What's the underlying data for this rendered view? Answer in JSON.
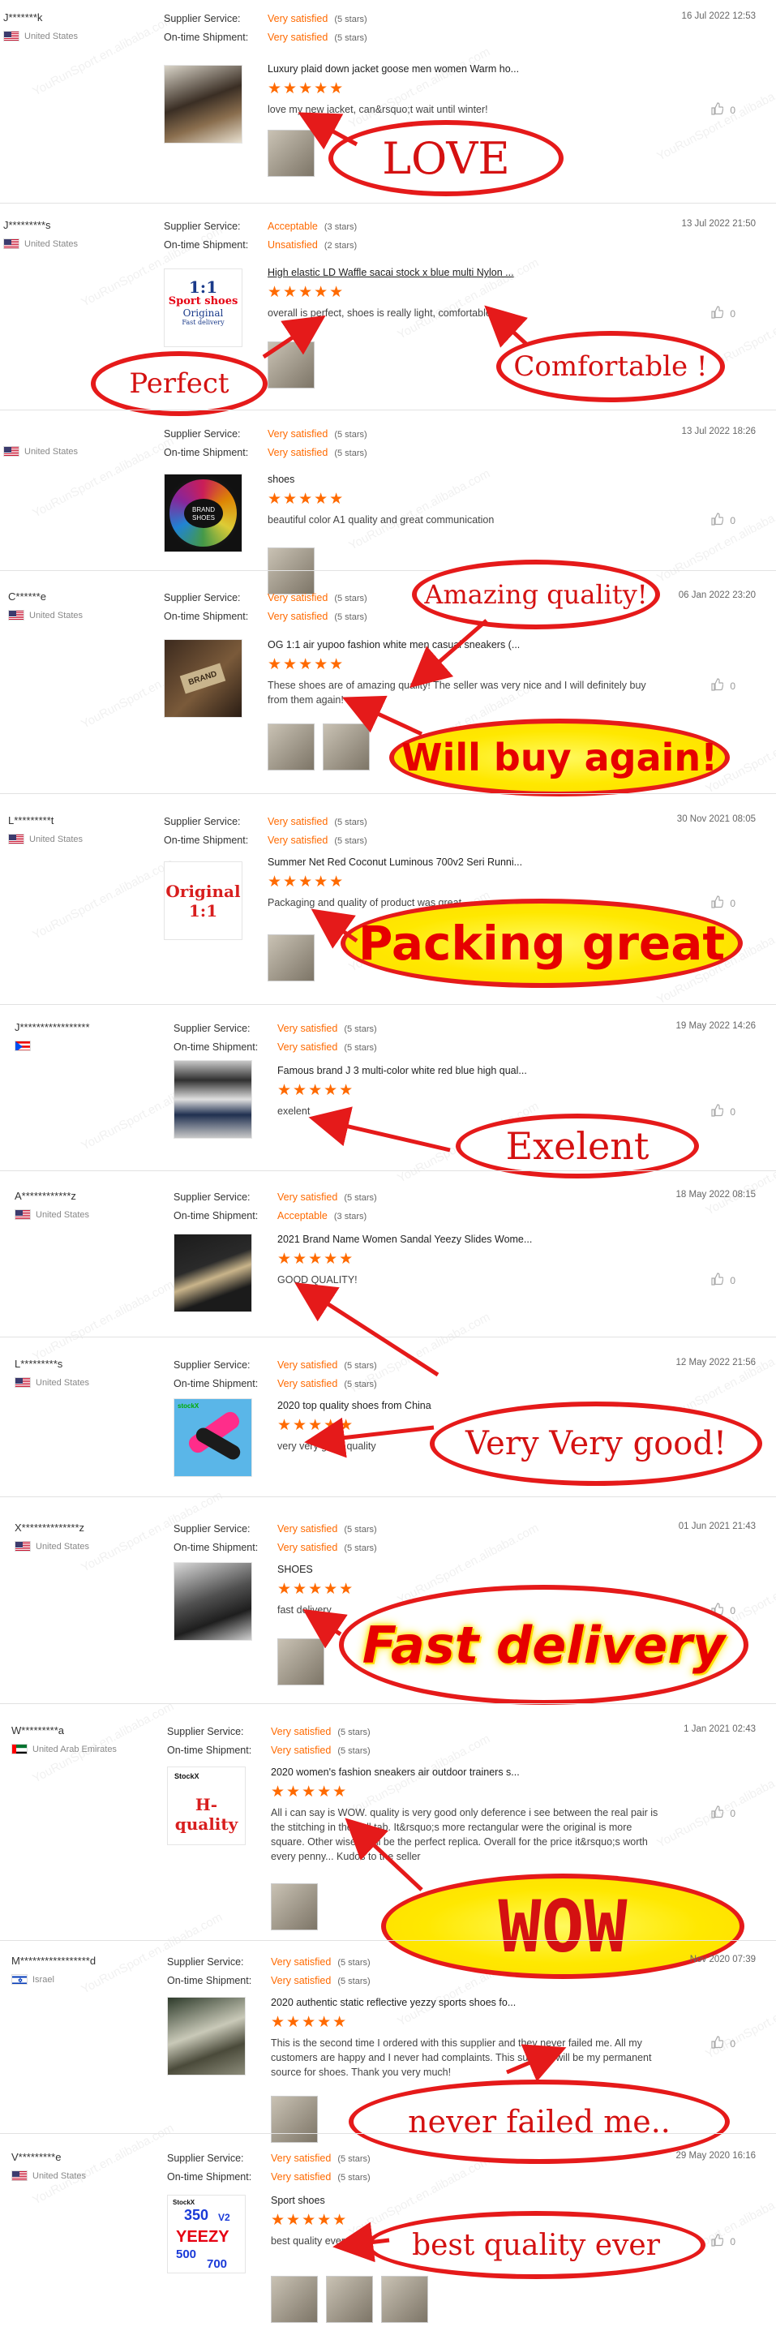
{
  "labels": {
    "supplier_service": "Supplier Service:",
    "on_time_shipment": "On-time Shipment:"
  },
  "watermark": "YouRunSport.en.alibaba.com",
  "reviews": [
    {
      "buyer": "J*******k",
      "country": "United States",
      "supplier_val": "Very satisfied",
      "supplier_stars": "(5 stars)",
      "shipment_val": "Very satisfied",
      "shipment_stars": "(5 stars)",
      "date": "16 Jul 2022 12:53",
      "product": "Luxury plaid down jacket goose men women Warm ho...",
      "rating": "★★★★★",
      "comment": "love my new jacket, can&rsquo;t wait until winter!",
      "likes": "0",
      "callout": "LOVE"
    },
    {
      "buyer": "J*********s",
      "country": "United States",
      "supplier_val": "Acceptable",
      "supplier_stars": "(3 stars)",
      "shipment_val": "Unsatisfied",
      "shipment_stars": "(2 stars)",
      "date": "13 Jul 2022 21:50",
      "product": "High elastic LD Waffle sacai stock x blue multi Nylon ...",
      "thumb_text": [
        "1:1",
        "Sport shoes",
        "Original",
        "Fast delivery"
      ],
      "rating": "★★★★★",
      "comment": "overall is perfect, shoes is really light, comfortable!",
      "likes": "0",
      "callout": "Perfect",
      "callout2": "Comfortable !"
    },
    {
      "buyer": "",
      "country": "United States",
      "supplier_val": "Very satisfied",
      "supplier_stars": "(5 stars)",
      "shipment_val": "Very satisfied",
      "shipment_stars": "(5 stars)",
      "date": "13 Jul 2022 18:26",
      "product": "shoes",
      "thumb_text": [
        "BRAND",
        "SHOES"
      ],
      "rating": "★★★★★",
      "comment": "beautiful color A1 quality and great communication",
      "likes": "0"
    },
    {
      "buyer": "C******e",
      "country": "United States",
      "supplier_val": "Very satisfied",
      "supplier_stars": "(5 stars)",
      "shipment_val": "Very satisfied",
      "shipment_stars": "(5 stars)",
      "date": "06 Jan 2022 23:20",
      "product": "OG 1:1 air yupoo fashion white men casual sneakers (...",
      "thumb_text": [
        "BRAND"
      ],
      "rating": "★★★★★",
      "comment": "These shoes are of amazing quality! The seller was very nice and I will definitely buy from them again!",
      "likes": "0",
      "callout": "Amazing quality!",
      "callout2": "Will buy again!"
    },
    {
      "buyer": "L*********t",
      "country": "United States",
      "supplier_val": "Very satisfied",
      "supplier_stars": "(5 stars)",
      "shipment_val": "Very satisfied",
      "shipment_stars": "(5 stars)",
      "date": "30 Nov 2021 08:05",
      "product": "Summer Net Red Coconut Luminous 700v2 Seri Runni...",
      "thumb_text": [
        "Original",
        "1:1"
      ],
      "rating": "★★★★★",
      "comment": "Packaging and quality of product was great.",
      "likes": "0",
      "callout": "Packing great"
    },
    {
      "buyer": "J*****************",
      "country": "",
      "supplier_val": "Very satisfied",
      "supplier_stars": "(5 stars)",
      "shipment_val": "Very satisfied",
      "shipment_stars": "(5 stars)",
      "date": "19 May 2022 14:26",
      "product": "Famous brand J 3 multi-color white red blue high qual...",
      "rating": "★★★★★",
      "comment": "exelent",
      "likes": "0",
      "callout": "Exelent"
    },
    {
      "buyer": "A************z",
      "country": "United States",
      "supplier_val": "Very satisfied",
      "supplier_stars": "(5 stars)",
      "shipment_val": "Acceptable",
      "shipment_stars": "(3 stars)",
      "date": "18 May 2022 08:15",
      "product": "2021 Brand Name Women Sandal Yeezy Slides Wome...",
      "rating": "★★★★★",
      "comment": "GOOD QUALITY!",
      "likes": "0"
    },
    {
      "buyer": "L*********s",
      "country": "United States",
      "supplier_val": "Very satisfied",
      "supplier_stars": "(5 stars)",
      "shipment_val": "Very satisfied",
      "shipment_stars": "(5 stars)",
      "date": "12 May 2022 21:56",
      "product": "2020 top quality shoes from China",
      "thumb_text": [
        "stockX"
      ],
      "rating": "★★★★★",
      "comment": "very very good quality",
      "likes": "0",
      "callout": "Very Very good!"
    },
    {
      "buyer": "X**************z",
      "country": "United States",
      "supplier_val": "Very satisfied",
      "supplier_stars": "(5 stars)",
      "shipment_val": "Very satisfied",
      "shipment_stars": "(5 stars)",
      "date": "01 Jun 2021 21:43",
      "product": "SHOES",
      "rating": "★★★★★",
      "comment": "fast delivery",
      "likes": "0",
      "callout": "Fast delivery"
    },
    {
      "buyer": "W*********a",
      "country": "United Arab Emirates",
      "supplier_val": "Very satisfied",
      "supplier_stars": "(5 stars)",
      "shipment_val": "Very satisfied",
      "shipment_stars": "(5 stars)",
      "date": "1 Jan 2021 02:43",
      "product": "2020 women's fashion sneakers air outdoor trainers s...",
      "thumb_text": [
        "StockX",
        "H-quality"
      ],
      "rating": "★★★★★",
      "comment": "All i can say is WOW. quality is very good only deference i see between the real pair is the stitching in the pull tab. It&rsquo;s more rectangular were the original is more square. Other wise it will be the perfect replica.  Overall for the price it&rsquo;s worth every penny... Kudos to the seller",
      "likes": "0",
      "callout": "WOW"
    },
    {
      "buyer": "M*****************d",
      "country": "Israel",
      "supplier_val": "Very satisfied",
      "supplier_stars": "(5 stars)",
      "shipment_val": "Very satisfied",
      "shipment_stars": "(5 stars)",
      "date": "Nov 2020 07:39",
      "product": "2020 authentic static reflective yezzy sports shoes fo...",
      "rating": "★★★★★",
      "comment": "This is the second time I ordered with this supplier and they never failed me.  All my customers are happy and I never had complaints. This supplier will be my permanent source for shoes. Thank you very much!",
      "likes": "0",
      "callout": "never failed me.."
    },
    {
      "buyer": "V*********e",
      "country": "United States",
      "supplier_val": "Very satisfied",
      "supplier_stars": "(5 stars)",
      "shipment_val": "Very satisfied",
      "shipment_stars": "(5 stars)",
      "date": "29 May 2020 16:16",
      "product": "Sport shoes",
      "thumb_text": [
        "StockX",
        "350",
        "V2",
        "YEEZY",
        "500",
        "700"
      ],
      "rating": "★★★★★",
      "comment": "best quality ever",
      "likes": "0",
      "callout": "best quality ever"
    }
  ],
  "colors": {
    "accent": "#ff6a00",
    "callout_red": "#e51a1a",
    "highlight_yellow": "#ffe800",
    "divider": "#e2e2e2"
  }
}
